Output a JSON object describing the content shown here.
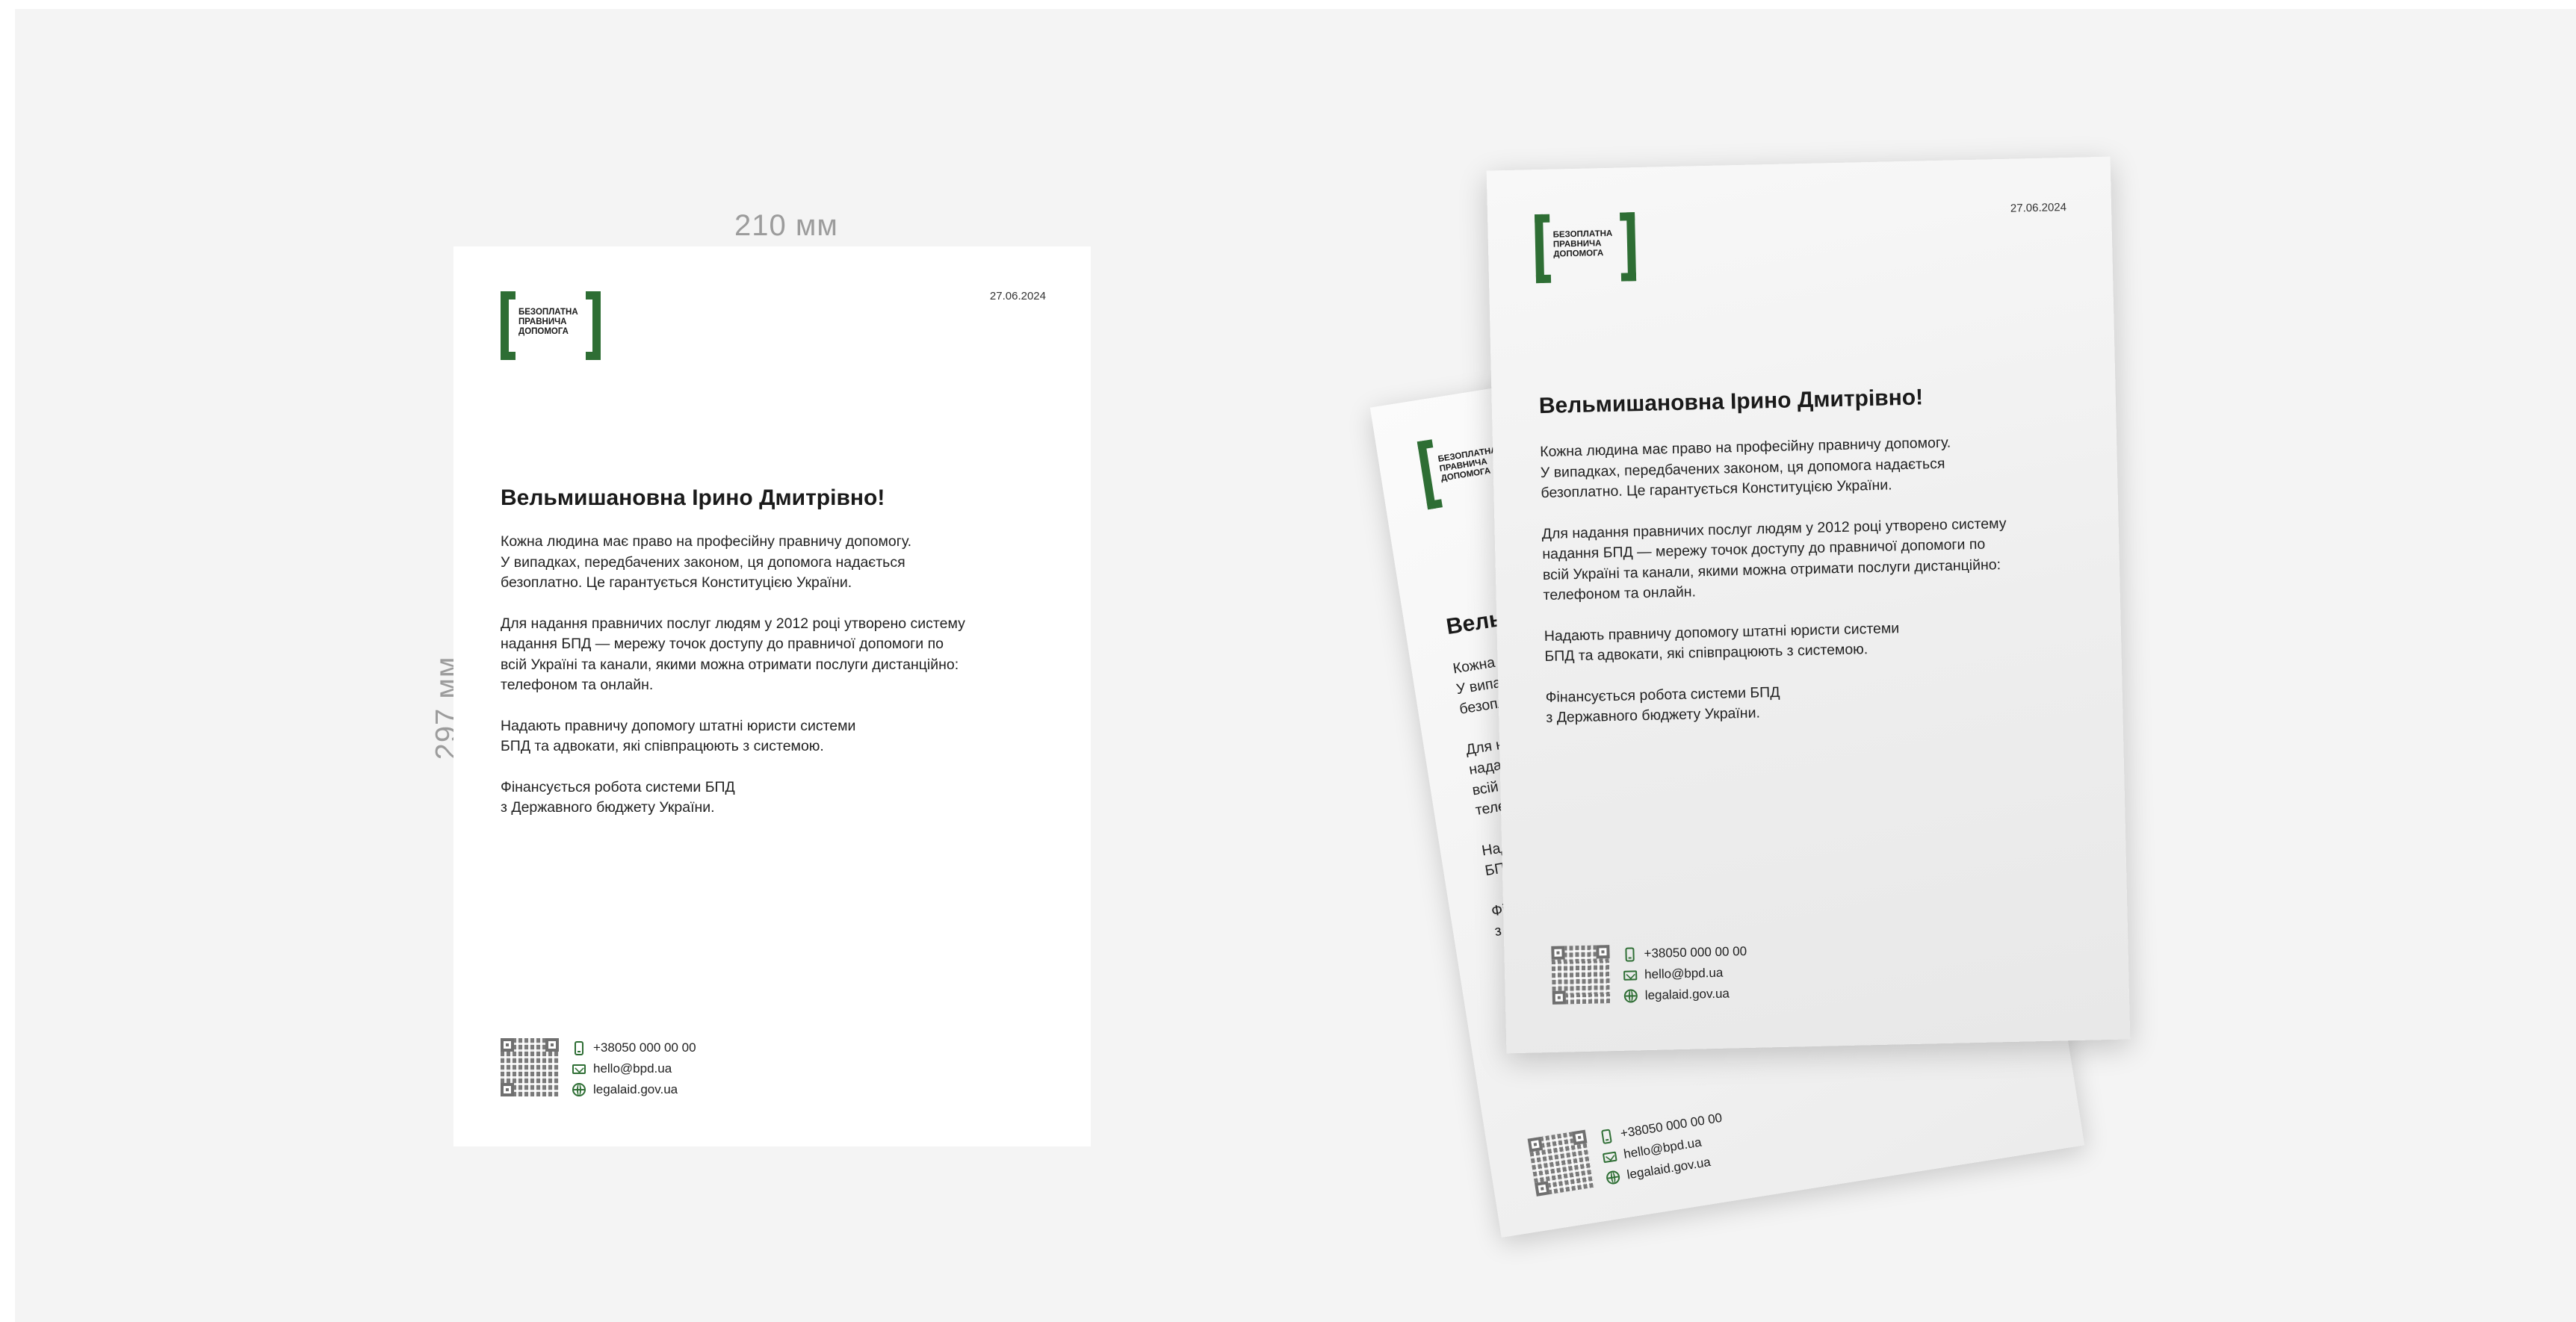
{
  "dimensions": {
    "width_label": "210 мм",
    "height_label": "297 мм"
  },
  "brand": {
    "accent": "#2e6e34",
    "logo_lines": [
      "БЕЗОПЛАТНА",
      "ПРАВНИЧА",
      "ДОПОМОГА"
    ]
  },
  "letter": {
    "date": "27.06.2024",
    "greeting": "Вельмишановна Ірино Дмитрівно!",
    "paragraphs": [
      [
        "Кожна людина має право на професійну правничу допомогу.",
        "У випадках, передбачених законом, ця допомога надається",
        "безоплатно. Це гарантується Конституцією України."
      ],
      [
        "Для надання правничих послуг людям у 2012 році утворено систему",
        "надання БПД — мережу точок доступу до правничої допомоги по",
        "всій Україні та канали, якими можна отримати послуги дистанційно:",
        "телефоном та онлайн."
      ],
      [
        "Надають правничу допомогу штатні юристи системи",
        "БПД та адвокати, які співпрацюють з системою."
      ],
      [
        "Фінансується робота системи БПД",
        "з Державного бюджету України."
      ]
    ],
    "contacts": {
      "phone": "+38050 000 00 00",
      "email": "hello@bpd.ua",
      "website": "legalaid.gov.ua"
    }
  }
}
